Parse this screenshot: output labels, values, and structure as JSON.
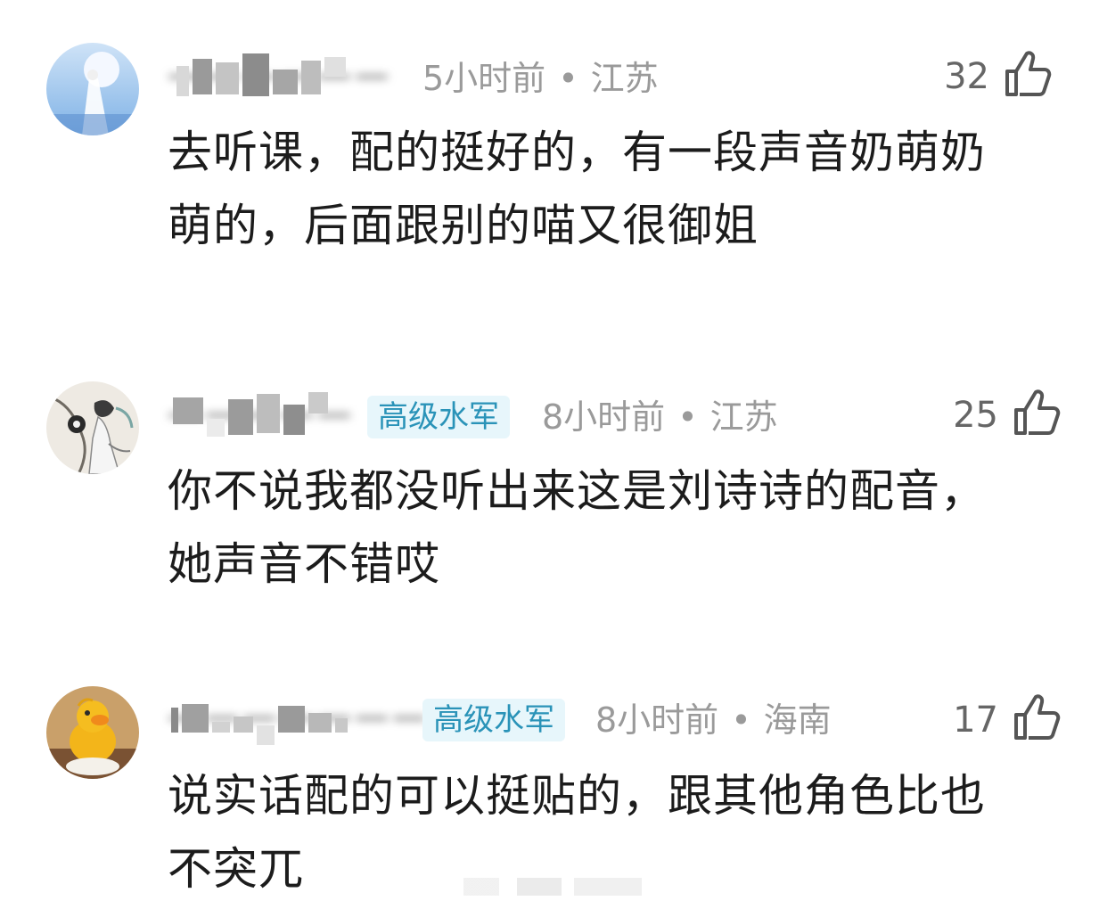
{
  "comments": [
    {
      "username": "一一一一一一",
      "badge": "",
      "time": "5小时前",
      "location": "江苏",
      "likes": "32",
      "text_line1": "去听课，配的挺好的，有一段声音奶萌奶",
      "text_line2": "萌的，后面跟别的喵又很御姐"
    },
    {
      "username": "一一一一一",
      "badge": "高级水军",
      "time": "8小时前",
      "location": "江苏",
      "likes": "25",
      "text_line1": "你不说我都没听出来这是刘诗诗的配音，",
      "text_line2": "她声音不错哎"
    },
    {
      "username": "一一一一一一一",
      "badge": "高级水军",
      "time": "8小时前",
      "location": "海南",
      "likes": "17",
      "text_line1": "说实话配的可以挺贴的，跟其他角色比也",
      "text_line2": "不突兀"
    }
  ],
  "separator_dot": "•",
  "icons": {
    "like": "thumbs-up-icon"
  },
  "colors": {
    "badge_bg": "#e7f6fb",
    "badge_text": "#2a93b8",
    "meta_text": "#9a9a9a",
    "body_text": "#1c1c1c"
  }
}
